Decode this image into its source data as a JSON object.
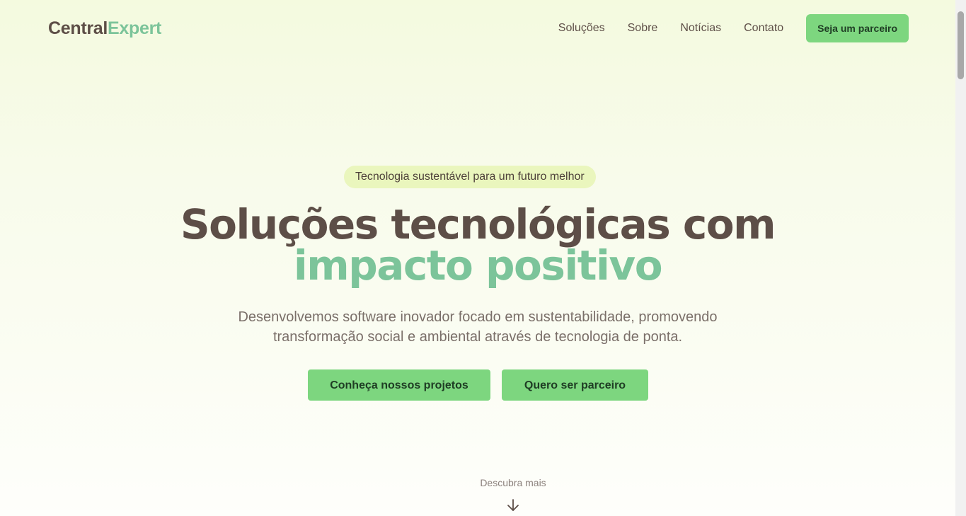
{
  "brand": {
    "name_part1": "Central",
    "name_part2": "Expert"
  },
  "nav": {
    "items": [
      "Soluções",
      "Sobre",
      "Notícias",
      "Contato"
    ],
    "cta_label": "Seja um parceiro"
  },
  "hero": {
    "badge": "Tecnologia sustentável para um futuro melhor",
    "title_line1": "Soluções tecnológicas com",
    "title_line2": "impacto positivo",
    "subtitle": "Desenvolvemos software inovador focado em sustentabilidade, promovendo transformação social e ambiental através de tecnologia de ponta.",
    "primary_button": "Conheça nossos projetos",
    "secondary_button": "Quero ser parceiro"
  },
  "scroll_hint": {
    "label": "Descubra mais",
    "icon": "arrow-down-icon"
  },
  "colors": {
    "brand_dark": "#5d4e47",
    "brand_green": "#7cc49a",
    "button_green": "#7dd67f",
    "badge_bg": "#eaf6bd"
  }
}
